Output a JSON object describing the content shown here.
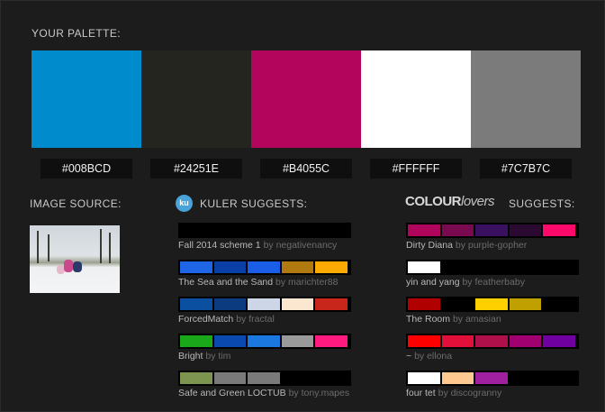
{
  "palette": {
    "heading": "YOUR PALETTE:",
    "colors": [
      {
        "hex": "#008BCD"
      },
      {
        "hex": "#24251E"
      },
      {
        "hex": "#B4055C"
      },
      {
        "hex": "#FFFFFF"
      },
      {
        "hex": "#7C7B7C"
      }
    ]
  },
  "image_source": {
    "heading": "IMAGE SOURCE:"
  },
  "kuler": {
    "badge": "ku",
    "heading": "KULER SUGGESTS:",
    "schemes": [
      {
        "name": "Fall 2014 scheme 1",
        "by": "by",
        "author": "negativenancy",
        "colors": [
          "#000000",
          "#000000",
          "#000000",
          "#000000",
          "#000000"
        ]
      },
      {
        "name": "The Sea and the Sand",
        "by": "by",
        "author": "marichter88",
        "colors": [
          "#1e66e6",
          "#0a3fa6",
          "#1a5ee8",
          "#b07a10",
          "#ffaa00"
        ]
      },
      {
        "name": "ForcedMatch",
        "by": "by",
        "author": "fractal",
        "colors": [
          "#0a4fa0",
          "#0c3b80",
          "#cdd6e6",
          "#fbe6d0",
          "#c8261a"
        ]
      },
      {
        "name": "Bright",
        "by": "by",
        "author": "tim",
        "colors": [
          "#1aa81a",
          "#0a4ab0",
          "#1a78e0",
          "#9a9a9a",
          "#ff1a80"
        ]
      },
      {
        "name": "Safe and Green LOCTUB",
        "by": "by",
        "author": "tony.mapes",
        "colors": [
          "#7c9450",
          "#7a7a7a",
          "#7a7a7a",
          "#000000",
          "#000000"
        ]
      }
    ]
  },
  "colourlovers": {
    "logo_bold": "COLOUR",
    "logo_light": "lovers",
    "heading": "SUGGESTS:",
    "schemes": [
      {
        "name": "Dirty Diana",
        "by": "by",
        "author": "purple-gopher",
        "colors": [
          "#b0055c",
          "#7a0a50",
          "#3a1060",
          "#2a0a30",
          "#ff0a6a"
        ]
      },
      {
        "name": "yin and yang",
        "by": "by",
        "author": "featherbaby",
        "colors": [
          "#ffffff",
          "#000000",
          "#000000",
          "#000000",
          "#000000"
        ]
      },
      {
        "name": "The Room",
        "by": "by",
        "author": "amasian",
        "colors": [
          "#b00000",
          "#000000",
          "#ffd000",
          "#c0a000",
          "#000000"
        ]
      },
      {
        "name": "~",
        "by": "by",
        "author": "ellona",
        "colors": [
          "#ff0000",
          "#e0103a",
          "#b0104a",
          "#a00070",
          "#7000a0"
        ]
      },
      {
        "name": "four tet",
        "by": "by",
        "author": "discogranny",
        "colors": [
          "#ffffff",
          "#ffc890",
          "#a020a0",
          "#000000",
          "#000000"
        ]
      }
    ]
  }
}
